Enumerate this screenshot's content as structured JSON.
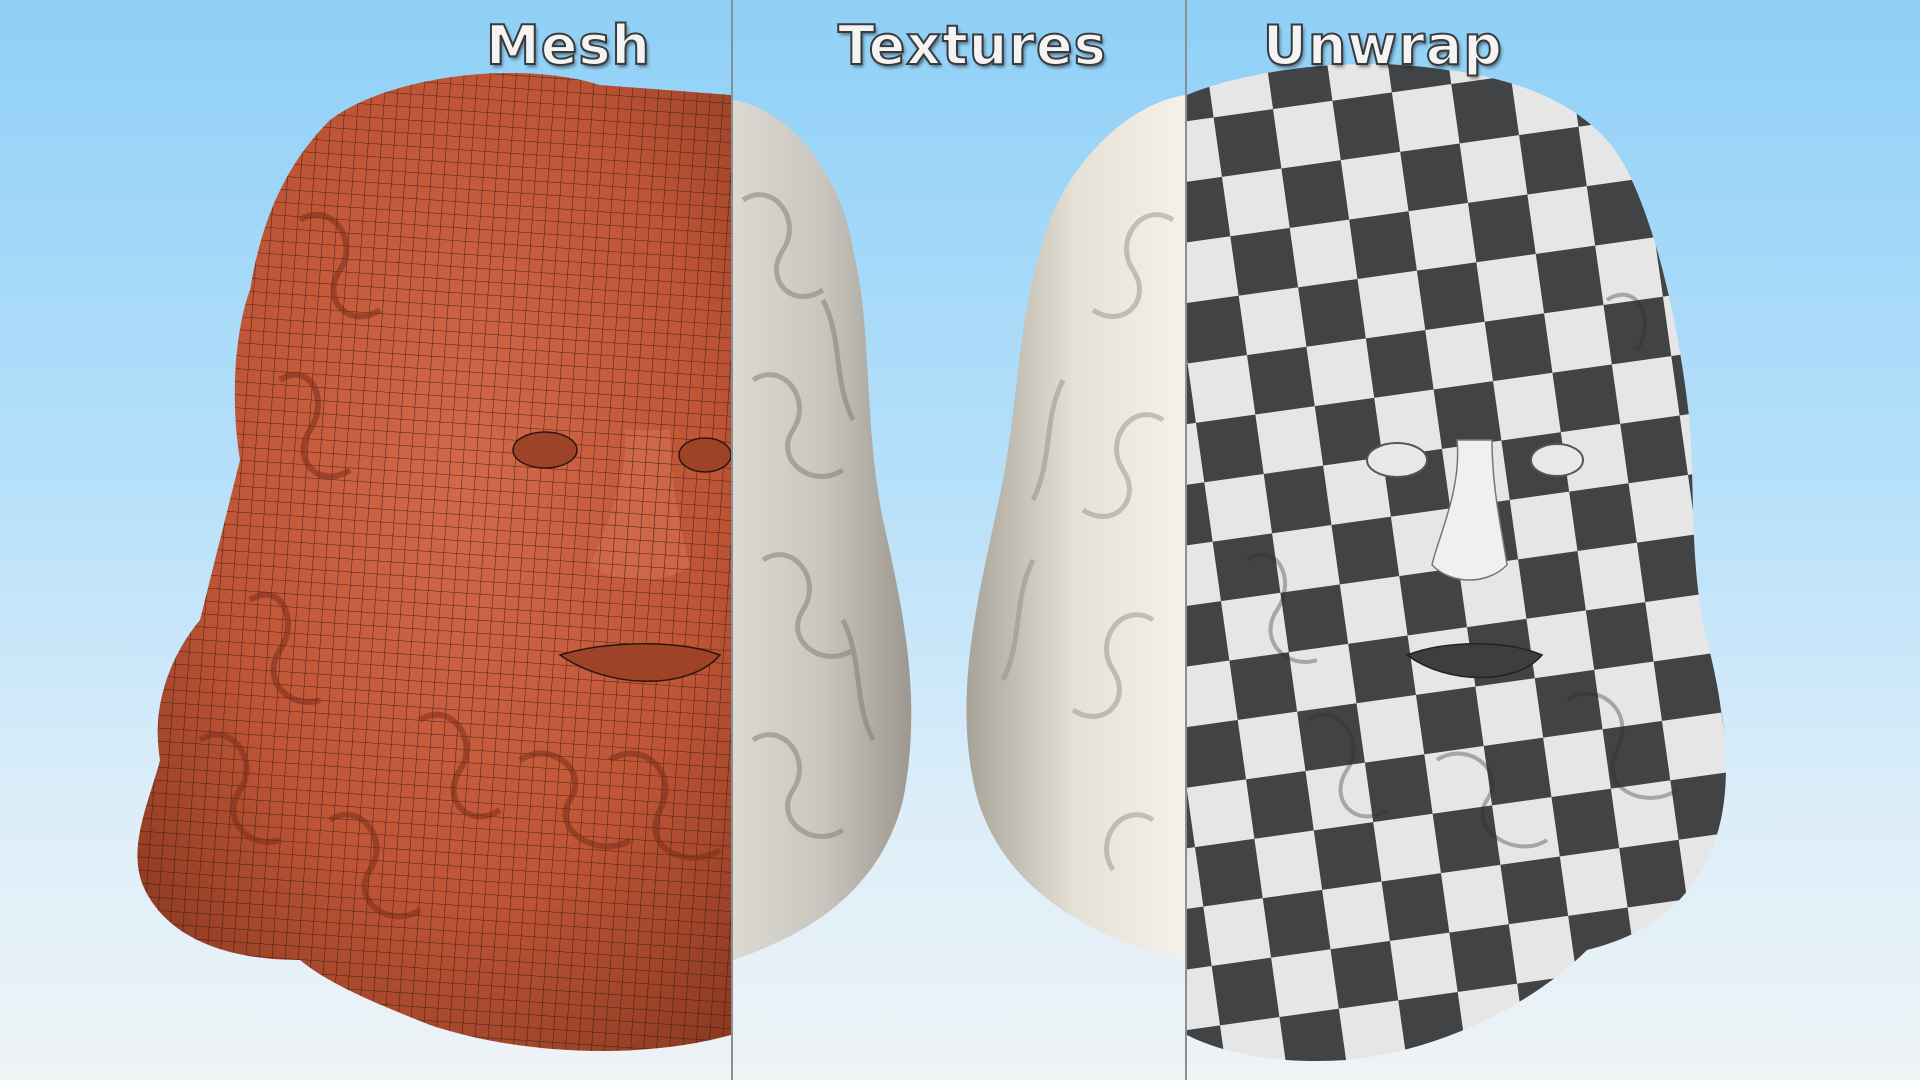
{
  "labels": {
    "mesh": "Mesh",
    "textures": "Textures",
    "unwrap": "Unwrap"
  },
  "colors": {
    "background_top": "#8fd0f7",
    "background_bottom": "#eef3f6",
    "mesh_surface": "#c65a3a",
    "mesh_wire": "#2a1610",
    "marble": "#e8e4dc",
    "checker_dark": "#474849",
    "checker_light": "#f5f5f5",
    "divider": "#8a8f94"
  }
}
